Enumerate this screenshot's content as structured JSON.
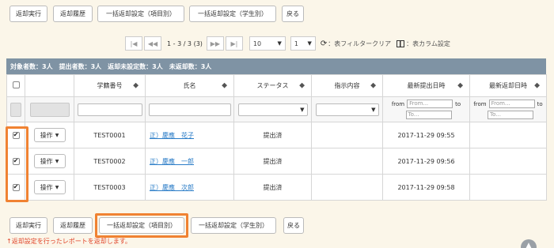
{
  "toolbar_top": {
    "return_exec": "返却実行",
    "return_history": "返却履歴",
    "bulk_item": "一括返却設定（項目別）",
    "bulk_student": "一括返却設定（学生別）",
    "back": "戻る"
  },
  "pager": {
    "range": "1 - 3 / 3 (3)",
    "per_page": "10",
    "page": "1",
    "filter_clear": "：表フィルタークリア",
    "column_settings": "：表カラム設定"
  },
  "summary": "対象者数：3人　提出者数：3人　返却未設定数：3人　未返却数：3人",
  "table": {
    "headers": [
      "",
      "",
      "学籍番号",
      "氏名",
      "ステータス",
      "指示内容",
      "最新提出日時",
      "最新返却日時"
    ],
    "filter_from": "from",
    "filter_to": "to",
    "placeholder_from": "From...",
    "placeholder_to": "To...",
    "rows": [
      {
        "op": "操作",
        "id": "TEST0001",
        "name": "正）慶應　花子",
        "status": "提出済",
        "instr": "",
        "submitted": "2017-11-29 09:55",
        "returned": ""
      },
      {
        "op": "操作",
        "id": "TEST0002",
        "name": "正）慶應　一郎",
        "status": "提出済",
        "instr": "",
        "submitted": "2017-11-29 09:56",
        "returned": ""
      },
      {
        "op": "操作",
        "id": "TEST0003",
        "name": "正）慶應　次郎",
        "status": "提出済",
        "instr": "",
        "submitted": "2017-11-29 09:58",
        "returned": ""
      }
    ]
  },
  "toolbar_bottom": {
    "return_exec": "返却実行",
    "return_history": "返却履歴",
    "bulk_item": "一括返却設定（項目別）",
    "bulk_student": "一括返却設定（学生別）",
    "back": "戻る"
  },
  "note": "↑返却設定を行ったレポートを返却します。",
  "colors": {
    "highlight": "#f08232",
    "summary_bg": "#7f93a4",
    "link": "#2a7cc7",
    "note": "#e0452a"
  }
}
